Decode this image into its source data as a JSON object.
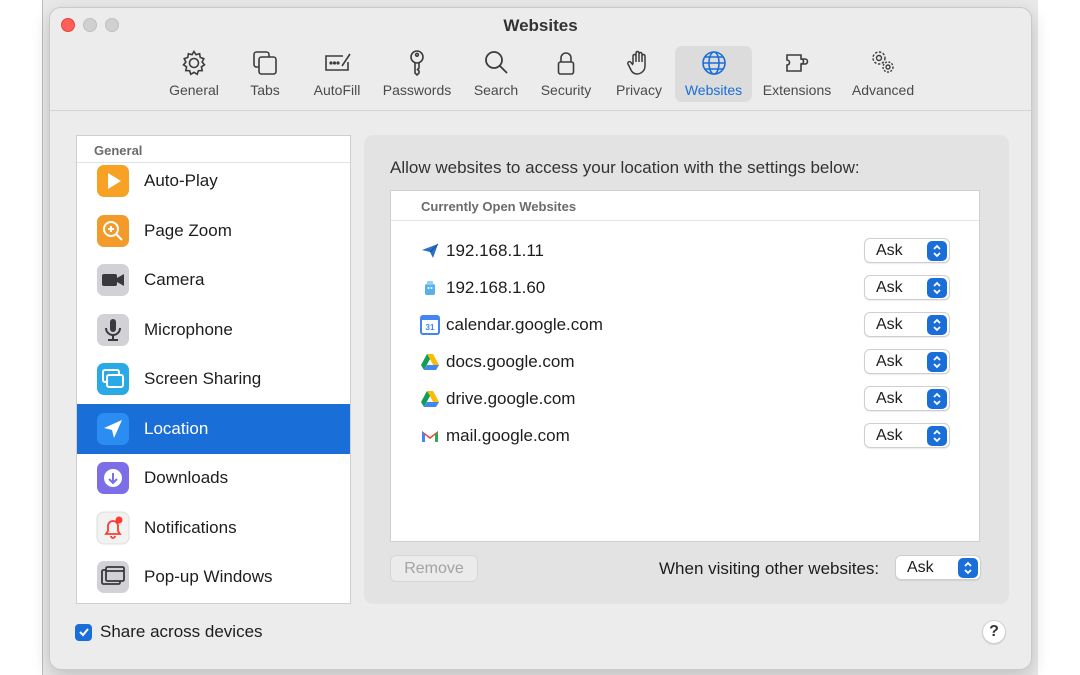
{
  "window": {
    "title": "Websites"
  },
  "toolbar": {
    "items": [
      {
        "label": "General",
        "icon": "gear-icon"
      },
      {
        "label": "Tabs",
        "icon": "tabs-icon"
      },
      {
        "label": "AutoFill",
        "icon": "autofill-icon"
      },
      {
        "label": "Passwords",
        "icon": "key-icon"
      },
      {
        "label": "Search",
        "icon": "search-icon"
      },
      {
        "label": "Security",
        "icon": "lock-icon"
      },
      {
        "label": "Privacy",
        "icon": "hand-icon"
      },
      {
        "label": "Websites",
        "icon": "globe-icon",
        "selected": true
      },
      {
        "label": "Extensions",
        "icon": "puzzle-icon"
      },
      {
        "label": "Advanced",
        "icon": "gears-icon"
      }
    ]
  },
  "sidebar": {
    "section_title": "General",
    "items": [
      {
        "label": "Auto-Play",
        "icon": "play-icon",
        "color": "#f7a224"
      },
      {
        "label": "Page Zoom",
        "icon": "zoom-icon",
        "color": "#f29b2a"
      },
      {
        "label": "Camera",
        "icon": "camera-icon",
        "color": "#3a3a3c"
      },
      {
        "label": "Microphone",
        "icon": "microphone-icon",
        "color": "#8e8e93"
      },
      {
        "label": "Screen Sharing",
        "icon": "screen-sharing-icon",
        "color": "#29a9e6"
      },
      {
        "label": "Location",
        "icon": "location-arrow-icon",
        "color": "#1a6ed8",
        "selected": true
      },
      {
        "label": "Downloads",
        "icon": "download-icon",
        "color": "#7d6ee8"
      },
      {
        "label": "Notifications",
        "icon": "bell-icon",
        "color": "#ff3b30"
      },
      {
        "label": "Pop-up Windows",
        "icon": "popup-window-icon",
        "color": "#8e8e93"
      }
    ]
  },
  "panel": {
    "prompt": "Allow websites to access your location with the settings below:",
    "table_header": "Currently Open Websites",
    "sites": [
      {
        "name": "192.168.1.11",
        "icon": "paper-plane-icon",
        "setting": "Ask"
      },
      {
        "name": "192.168.1.60",
        "icon": "robot-icon",
        "setting": "Ask"
      },
      {
        "name": "calendar.google.com",
        "icon": "google-calendar-icon",
        "setting": "Ask"
      },
      {
        "name": "docs.google.com",
        "icon": "google-drive-icon",
        "setting": "Ask"
      },
      {
        "name": "drive.google.com",
        "icon": "google-drive-icon",
        "setting": "Ask"
      },
      {
        "name": "mail.google.com",
        "icon": "gmail-icon",
        "setting": "Ask"
      }
    ],
    "remove_label": "Remove",
    "other_sites_label": "When visiting other websites:",
    "other_sites_setting": "Ask"
  },
  "footer": {
    "share_label": "Share across devices",
    "share_checked": true,
    "help_label": "?"
  },
  "colors": {
    "accent": "#1a6ed8",
    "close": "#ff5f57"
  }
}
